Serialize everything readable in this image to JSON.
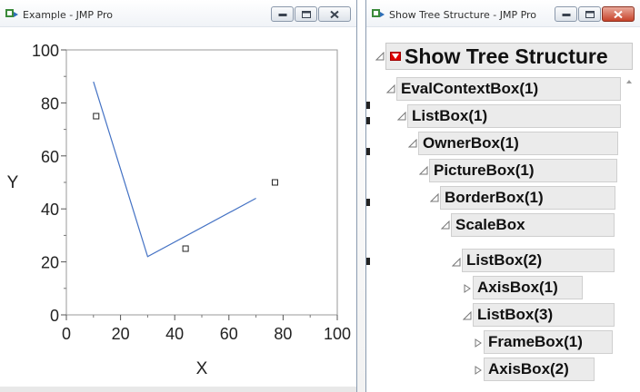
{
  "window_left": {
    "title": "Example - JMP Pro",
    "chart_data": {
      "type": "line",
      "xlabel": "X",
      "ylabel": "Y",
      "xlim": [
        0,
        100
      ],
      "ylim": [
        0,
        100
      ],
      "x_ticks": [
        "0",
        "20",
        "40",
        "60",
        "80",
        "100"
      ],
      "y_ticks": [
        "0",
        "20",
        "40",
        "60",
        "80",
        "100"
      ],
      "line": {
        "x": [
          10,
          30,
          70
        ],
        "y": [
          88,
          22,
          44
        ],
        "color": "#4472c4"
      },
      "points": {
        "x": [
          11,
          44,
          77
        ],
        "y": [
          75,
          25,
          50
        ],
        "marker": "open-square"
      },
      "grid": false
    }
  },
  "window_right": {
    "title": "Show Tree Structure - JMP Pro",
    "root_label": "Show Tree Structure",
    "nodes": [
      {
        "label": "EvalContextBox(1)",
        "expanded": true
      },
      {
        "label": "ListBox(1)",
        "expanded": true
      },
      {
        "label": "OwnerBox(1)",
        "expanded": true
      },
      {
        "label": "PictureBox(1)",
        "expanded": true
      },
      {
        "label": "BorderBox(1)",
        "expanded": true
      },
      {
        "label": "ScaleBox",
        "expanded": true
      },
      {
        "label": "ListBox(2)",
        "expanded": true
      },
      {
        "label": "AxisBox(1)",
        "expanded": false
      },
      {
        "label": "ListBox(3)",
        "expanded": true
      },
      {
        "label": "FrameBox(1)",
        "expanded": false
      },
      {
        "label": "AxisBox(2)",
        "expanded": false
      }
    ]
  },
  "colors": {
    "red_menu_triangle": "#e00000",
    "plot_line": "#4472c4",
    "frame": "#9a9a9a"
  }
}
